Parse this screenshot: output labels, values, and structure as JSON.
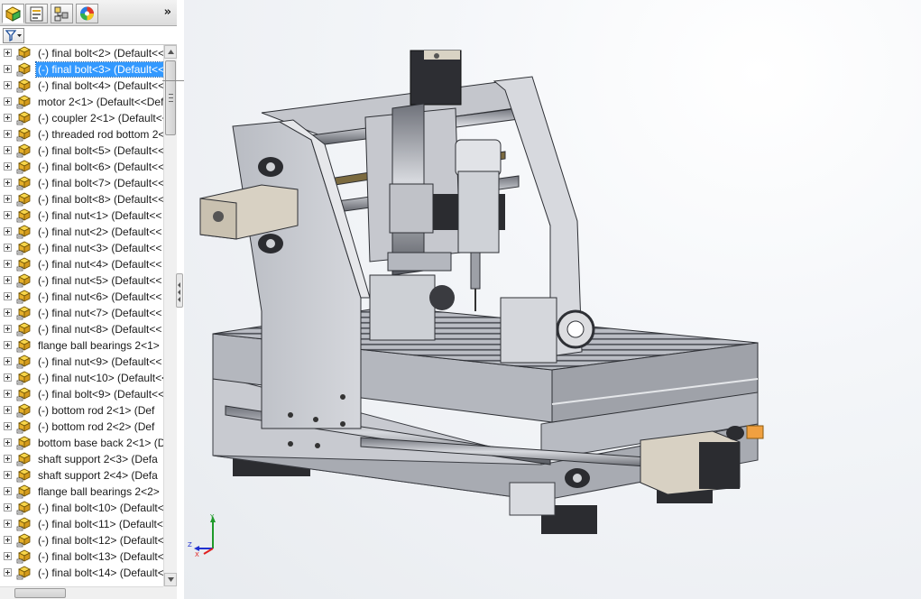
{
  "panel": {
    "tabs": [
      {
        "icon": "feature-manager-icon"
      },
      {
        "icon": "property-manager-icon"
      },
      {
        "icon": "configuration-manager-icon"
      },
      {
        "icon": "display-manager-icon"
      }
    ],
    "expand_glyph": "»",
    "filter_icon": "filter-icon"
  },
  "tree": {
    "items": [
      {
        "label": "(-) final bolt<2> (Default<<"
      },
      {
        "label": "(-) final bolt<3> (Default<<",
        "selected": true
      },
      {
        "label": "(-) final bolt<4> (Default<<"
      },
      {
        "label": "motor 2<1> (Default<<Defau"
      },
      {
        "label": "(-) coupler 2<1> (Default<<"
      },
      {
        "label": "(-) threaded rod bottom 2<"
      },
      {
        "label": "(-) final bolt<5> (Default<<"
      },
      {
        "label": "(-) final bolt<6> (Default<<"
      },
      {
        "label": "(-) final bolt<7> (Default<<"
      },
      {
        "label": "(-) final bolt<8> (Default<<"
      },
      {
        "label": "(-) final nut<1> (Default<<"
      },
      {
        "label": "(-) final nut<2> (Default<<"
      },
      {
        "label": "(-) final nut<3> (Default<<"
      },
      {
        "label": "(-) final nut<4> (Default<<"
      },
      {
        "label": "(-) final nut<5> (Default<<"
      },
      {
        "label": "(-) final nut<6> (Default<<"
      },
      {
        "label": "(-) final nut<7> (Default<<"
      },
      {
        "label": "(-) final nut<8> (Default<<"
      },
      {
        "label": "flange ball bearings 2<1>"
      },
      {
        "label": "(-) final nut<9> (Default<<"
      },
      {
        "label": "(-) final nut<10> (Default<<"
      },
      {
        "label": "(-) final bolt<9> (Default<<"
      },
      {
        "label": "(-) bottom rod 2<1> (Def"
      },
      {
        "label": "(-) bottom rod 2<2> (Def"
      },
      {
        "label": "bottom base back 2<1> (D"
      },
      {
        "label": "shaft support 2<3> (Defa"
      },
      {
        "label": "shaft support 2<4> (Defa"
      },
      {
        "label": "flange ball bearings 2<2>"
      },
      {
        "label": "(-) final bolt<10> (Default<"
      },
      {
        "label": "(-) final bolt<11> (Default<"
      },
      {
        "label": "(-) final bolt<12> (Default<"
      },
      {
        "label": "(-) final bolt<13> (Default<"
      },
      {
        "label": "(-) final bolt<14> (Default<"
      }
    ],
    "part_icon": "part-component-icon"
  },
  "viewport": {
    "model": "cnc-router-assembly",
    "triad": {
      "x": "X",
      "y": "Y",
      "z": "Z"
    }
  },
  "colors": {
    "selection": "#3399ff",
    "plate": "#c7c9cf",
    "bed": "#a9acb3",
    "motor": "#d6cfc2",
    "axis_x": "#e02020",
    "axis_y": "#1f9a2a",
    "axis_z": "#2030d0"
  }
}
